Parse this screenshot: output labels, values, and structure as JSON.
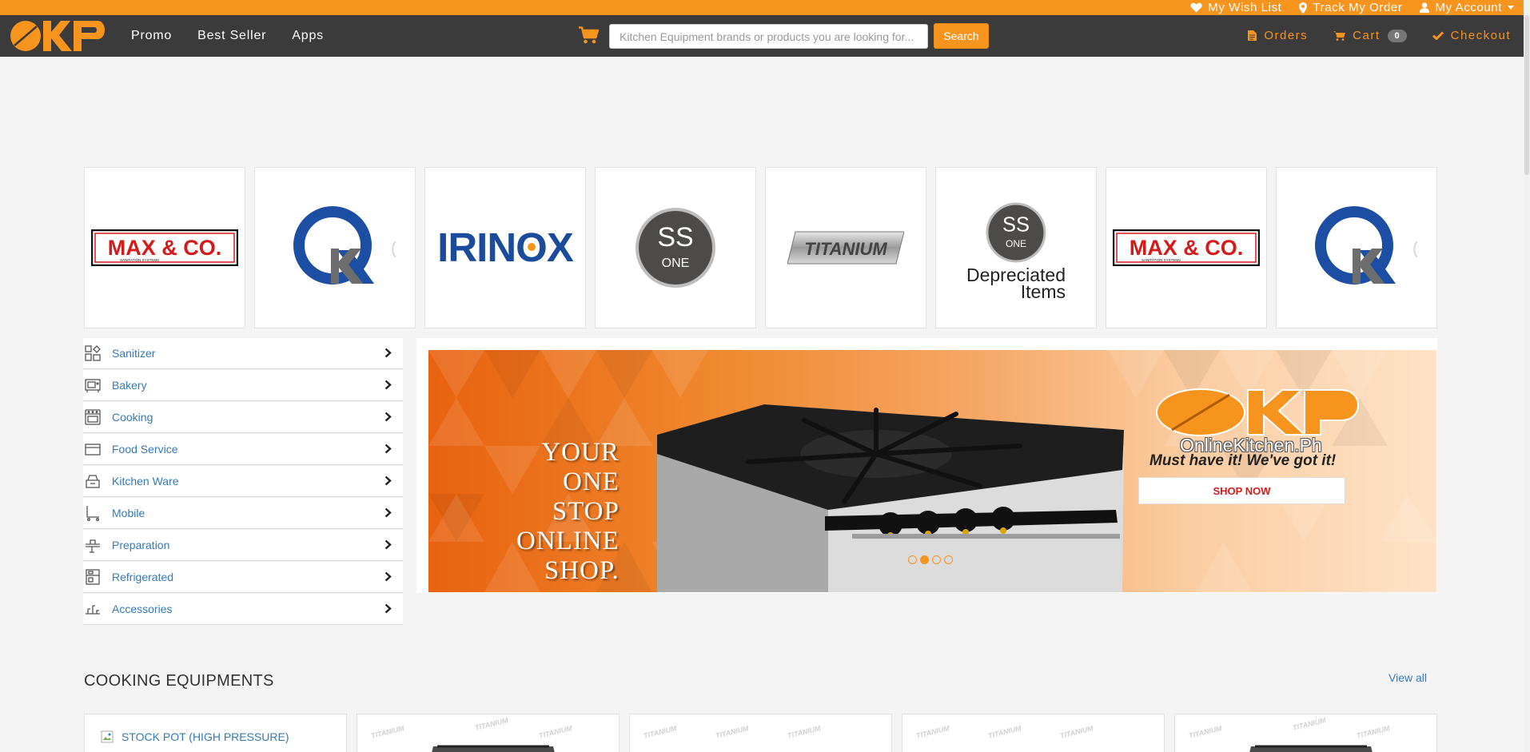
{
  "colors": {
    "accent": "#f7941e",
    "nav_bg": "#3b3b3b",
    "link": "#337ab7",
    "cta_text": "#d51c1c"
  },
  "topbar": {
    "links": [
      {
        "icon": "heart-icon",
        "label": "My Wish List"
      },
      {
        "icon": "map-marker-icon",
        "label": "Track My Order"
      },
      {
        "icon": "user-icon",
        "label": "My Account"
      }
    ]
  },
  "navbar": {
    "logo_text": "OKP",
    "links": [
      "Promo",
      "Best Seller",
      "Apps"
    ],
    "search": {
      "placeholder": "Kitchen Equipment brands or products you are looking for...",
      "value": "",
      "button_label": "Search"
    },
    "right": [
      {
        "icon": "file-icon",
        "label": "Orders"
      },
      {
        "icon": "cart-icon",
        "label": "Cart",
        "badge": "0"
      },
      {
        "icon": "check-icon",
        "label": "Checkout"
      }
    ]
  },
  "brands": [
    {
      "name": "MAX & CO.",
      "sub": "SANITATION SYSTEMS"
    },
    {
      "name": "QK"
    },
    {
      "name": "IRINOX"
    },
    {
      "name": "SS ONE"
    },
    {
      "name": "TITANIUM"
    },
    {
      "name": "SS ONE",
      "caption_line1": "Depreciated",
      "caption_line2": "Items"
    },
    {
      "name": "MAX & CO.",
      "sub": "SANITATION SYSTEMS"
    },
    {
      "name": "QK"
    }
  ],
  "categories": [
    {
      "label": "Sanitizer",
      "icon": "sanitizer-icon"
    },
    {
      "label": "Bakery",
      "icon": "bakery-icon"
    },
    {
      "label": "Cooking",
      "icon": "cooking-icon"
    },
    {
      "label": "Food Service",
      "icon": "food-service-icon"
    },
    {
      "label": "Kitchen Ware",
      "icon": "kitchen-ware-icon"
    },
    {
      "label": "Mobile",
      "icon": "mobile-icon"
    },
    {
      "label": "Preparation",
      "icon": "preparation-icon"
    },
    {
      "label": "Refrigerated",
      "icon": "refrigerated-icon"
    },
    {
      "label": "Accessories",
      "icon": "accessories-icon"
    }
  ],
  "banner": {
    "headline": [
      "YOUR",
      "ONE",
      "STOP",
      "ONLINE",
      "SHOP."
    ],
    "brand_logo": "OKP",
    "brand_site": "OnlineKitchen.Ph",
    "tagline": "Must have it! We've got it!",
    "cta": "SHOP NOW",
    "slides": 4,
    "active_slide": 2
  },
  "section": {
    "title": "COOKING EQUIPMENTS",
    "view_all": "View all",
    "products": [
      {
        "alt": "STOCK POT (HIGH PRESSURE)",
        "broken_image": true
      },
      {
        "watermark": "TITANIUM"
      },
      {
        "watermark": "TITANIUM"
      },
      {
        "watermark": "TITANIUM"
      },
      {
        "watermark": "TITANIUM"
      }
    ]
  }
}
